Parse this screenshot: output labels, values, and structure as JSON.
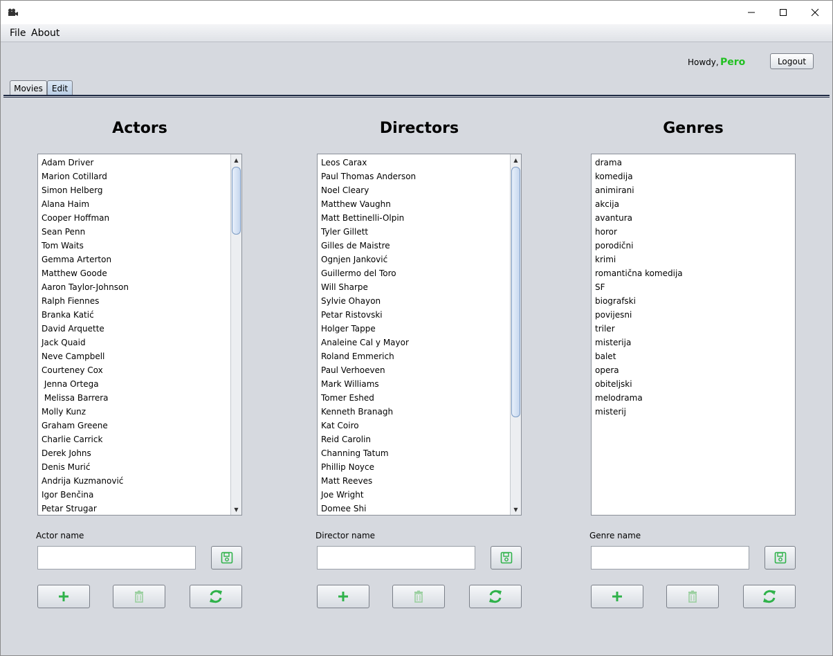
{
  "window": {
    "icon": "camera-icon"
  },
  "menubar": {
    "items": [
      {
        "label": "File"
      },
      {
        "label": "About"
      }
    ]
  },
  "header": {
    "greeting": "Howdy,",
    "user": "Pero",
    "logout_label": "Logout",
    "accent_color": "#22c022"
  },
  "tabs": [
    {
      "label": "Movies",
      "selected": false
    },
    {
      "label": "Edit",
      "selected": true
    }
  ],
  "actors": {
    "title": "Actors",
    "items": [
      "Adam Driver",
      "Marion Cotillard",
      "Simon Helberg",
      "Alana Haim",
      "Cooper Hoffman",
      "Sean Penn",
      "Tom Waits",
      "Gemma Arterton",
      "Matthew Goode",
      "Aaron Taylor-Johnson",
      "Ralph Fiennes",
      "Branka Katić",
      "David Arquette",
      "Jack Quaid",
      "Neve Campbell",
      "Courteney Cox",
      " Jenna Ortega",
      " Melissa Barrera",
      "Molly Kunz",
      "Graham Greene",
      "Charlie Carrick",
      "Derek Johns",
      "Denis Murić",
      "Andrija Kuzmanović",
      "Igor Benčina",
      "Petar Strugar"
    ],
    "field_label": "Actor name",
    "field_value": "",
    "scroll_position": 0.0,
    "scroll_visible_fraction": 0.2
  },
  "directors": {
    "title": "Directors",
    "items": [
      "Leos Carax",
      "Paul Thomas Anderson",
      "Noel Cleary",
      "Matthew Vaughn",
      "Matt Bettinelli-Olpin",
      "Tyler Gillett",
      "Gilles de Maistre",
      "Ognjen Janković",
      "Guillermo del Toro",
      "Will Sharpe",
      "Sylvie Ohayon",
      "Petar Ristovski",
      "Holger Tappe",
      "Analeine Cal y Mayor",
      "Roland Emmerich",
      "Paul Verhoeven",
      "Mark Williams",
      "Tomer Eshed",
      "Kenneth Branagh",
      "Kat Coiro",
      "Reid Carolin",
      "Channing Tatum",
      "Phillip Noyce",
      "Matt Reeves",
      "Joe Wright",
      "Domee Shi"
    ],
    "field_label": "Director name",
    "field_value": "",
    "scroll_position": 0.0,
    "scroll_visible_fraction": 0.74
  },
  "genres": {
    "title": "Genres",
    "items": [
      "drama",
      "komedija",
      "animirani",
      "akcija",
      "avantura",
      "horor",
      "porodični",
      "krimi",
      "romantična komedija",
      "SF",
      "biografski",
      "povijesni",
      "triler",
      "misterija",
      "balet",
      "opera",
      "obiteljski",
      "melodrama",
      "misterij"
    ],
    "field_label": "Genre name",
    "field_value": ""
  },
  "icons": {
    "save": "save-icon",
    "add": "plus-icon",
    "delete": "trash-icon",
    "refresh": "refresh-icon",
    "color": "#2fb24a"
  }
}
